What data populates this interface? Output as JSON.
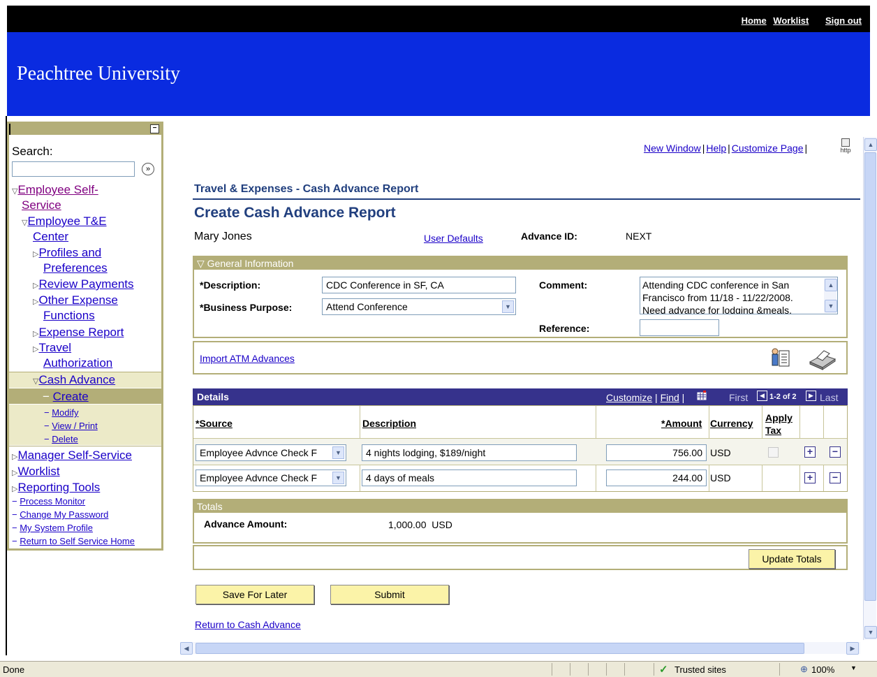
{
  "header": {
    "links": [
      "Home",
      "Worklist",
      "Sign out"
    ],
    "brand": "Peachtree University"
  },
  "nav": {
    "search_label": "Search:",
    "search_value": "",
    "items": {
      "ess_1": "Employee Self-",
      "ess_2": "Service",
      "te_1": "Employee T&E",
      "te_2": "Center",
      "prof_1": "Profiles and",
      "prof_2": "Preferences",
      "review": "Review Payments",
      "other_1": "Other Expense",
      "other_2": "Functions",
      "expense": "Expense Report",
      "travel_1": "Travel",
      "travel_2": "Authorization",
      "cash": "Cash Advance",
      "create": "Create",
      "modify": "Modify",
      "view": "View / Print",
      "delete": "Delete",
      "mss": "Manager Self-Service",
      "worklist": "Worklist",
      "reporting": "Reporting Tools",
      "process": "Process Monitor",
      "password": "Change My Password",
      "profile": "My System Profile",
      "return_home": "Return to Self Service Home"
    }
  },
  "page_links": {
    "new_window": "New Window",
    "help": "Help",
    "customize": "Customize Page",
    "http": "http"
  },
  "section_title": "Travel & Expenses - Cash Advance Report",
  "page_title": "Create Cash Advance Report",
  "user_name": "Mary Jones",
  "user_defaults": "User Defaults",
  "advance_id_label": "Advance ID:",
  "advance_id_value": "NEXT",
  "general": {
    "heading": "General Information",
    "description_label": "*Description:",
    "description_value": "CDC Conference in SF, CA",
    "purpose_label": "*Business Purpose:",
    "purpose_value": "Attend Conference",
    "comment_label": "Comment:",
    "comment_value": "Attending CDC conference in San Francisco from 11/18 - 11/22/2008. Need advance for lodging &meals.",
    "reference_label": "Reference:",
    "reference_value": ""
  },
  "import_atm": "Import ATM Advances",
  "details": {
    "heading": "Details",
    "customize": "Customize",
    "find": "Find",
    "first": "First",
    "range": "1-2 of 2",
    "last": "Last",
    "columns": {
      "source": "*Source",
      "description": "Description",
      "amount": "*Amount",
      "currency": "Currency",
      "apply_1": "Apply",
      "apply_2": "Tax"
    },
    "rows": [
      {
        "source": "Employee Advnce Check F",
        "description": "4 nights lodging, $189/night",
        "amount": "756.00",
        "currency": "USD"
      },
      {
        "source": "Employee Advnce Check F",
        "description": "4 days of meals",
        "amount": "244.00",
        "currency": "USD"
      }
    ]
  },
  "totals": {
    "heading": "Totals",
    "advance_label": "Advance Amount:",
    "advance_value": "1,000.00",
    "currency": "USD",
    "update_btn": "Update Totals"
  },
  "buttons": {
    "save": "Save For Later",
    "submit": "Submit"
  },
  "return_link": "Return to Cash Advance",
  "statusbar": {
    "text": "Done",
    "zone": "Trusted sites",
    "zoom": "100%"
  }
}
